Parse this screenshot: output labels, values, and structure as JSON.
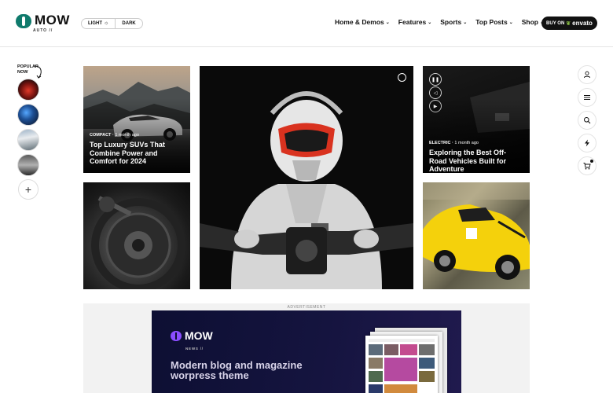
{
  "header": {
    "logo_text": "MOW",
    "logo_sub": "AUTO //",
    "mode": {
      "light": "LIGHT",
      "dark": "DARK"
    },
    "nav": [
      {
        "label": "Home & Demos"
      },
      {
        "label": "Features"
      },
      {
        "label": "Sports"
      },
      {
        "label": "Top Posts"
      },
      {
        "label": "Shop"
      }
    ],
    "buy": {
      "prefix": "BUY ON",
      "brand": "envato"
    }
  },
  "popular": {
    "label_line1": "POPULAR",
    "label_line2": "NOW",
    "thumbs": [
      "red-sports-car",
      "blue-dashboard",
      "white-suv",
      "silver-car"
    ],
    "add_icon": "plus-icon"
  },
  "rail": {
    "icons": [
      "user-icon",
      "menu-icon",
      "search-icon",
      "bolt-icon",
      "cart-icon"
    ]
  },
  "cards": [
    {
      "category": "COMPACT",
      "date": "1 month ago",
      "title": "Top Luxury SUVs That Combine Power and Comfort for 2024"
    },
    {
      "category": "",
      "date": "",
      "title": ""
    },
    {
      "category": "",
      "date": "",
      "title": ""
    },
    {
      "category": "ELECTRIC",
      "date": "1 month ago",
      "title": "Exploring the Best Off-Road Vehicles Built for Adventure"
    },
    {
      "category": "",
      "date": "",
      "title": ""
    }
  ],
  "ad": {
    "label": "ADVERTISEMENT",
    "logo_text": "MOW",
    "logo_sub": "NEWS //",
    "headline": "Modern blog and magazine worpress theme"
  },
  "colors": {
    "brand": "#0f7a6c",
    "ad_bg": "#0d0f33",
    "ad_accent": "#8a4dff"
  }
}
